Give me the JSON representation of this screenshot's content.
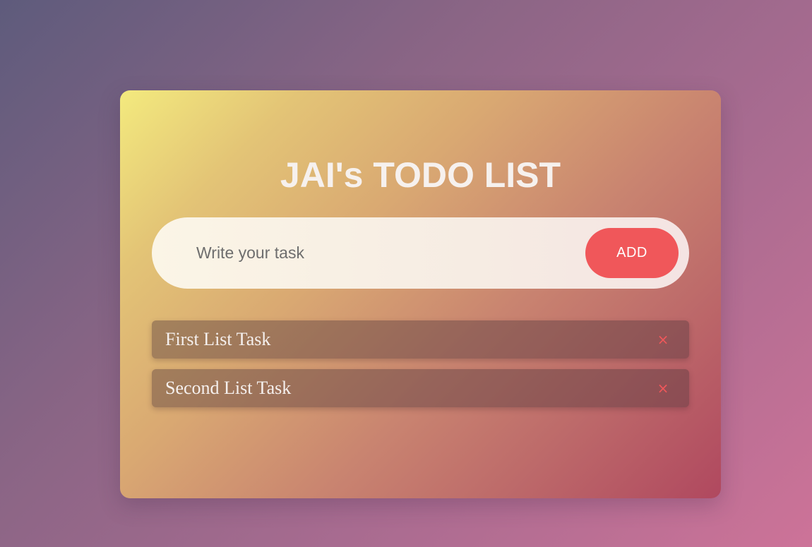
{
  "app": {
    "title": "JAI's TODO LIST"
  },
  "input": {
    "value": "",
    "placeholder": "Write your task"
  },
  "buttons": {
    "add_label": "ADD"
  },
  "tasks": [
    {
      "text": "First List Task",
      "delete_icon": "close-icon",
      "delete_glyph": "×"
    },
    {
      "text": "Second List Task",
      "delete_icon": "close-icon",
      "delete_glyph": "×"
    }
  ],
  "colors": {
    "accent": "#f0575a",
    "title_text": "#f6f1ee"
  }
}
